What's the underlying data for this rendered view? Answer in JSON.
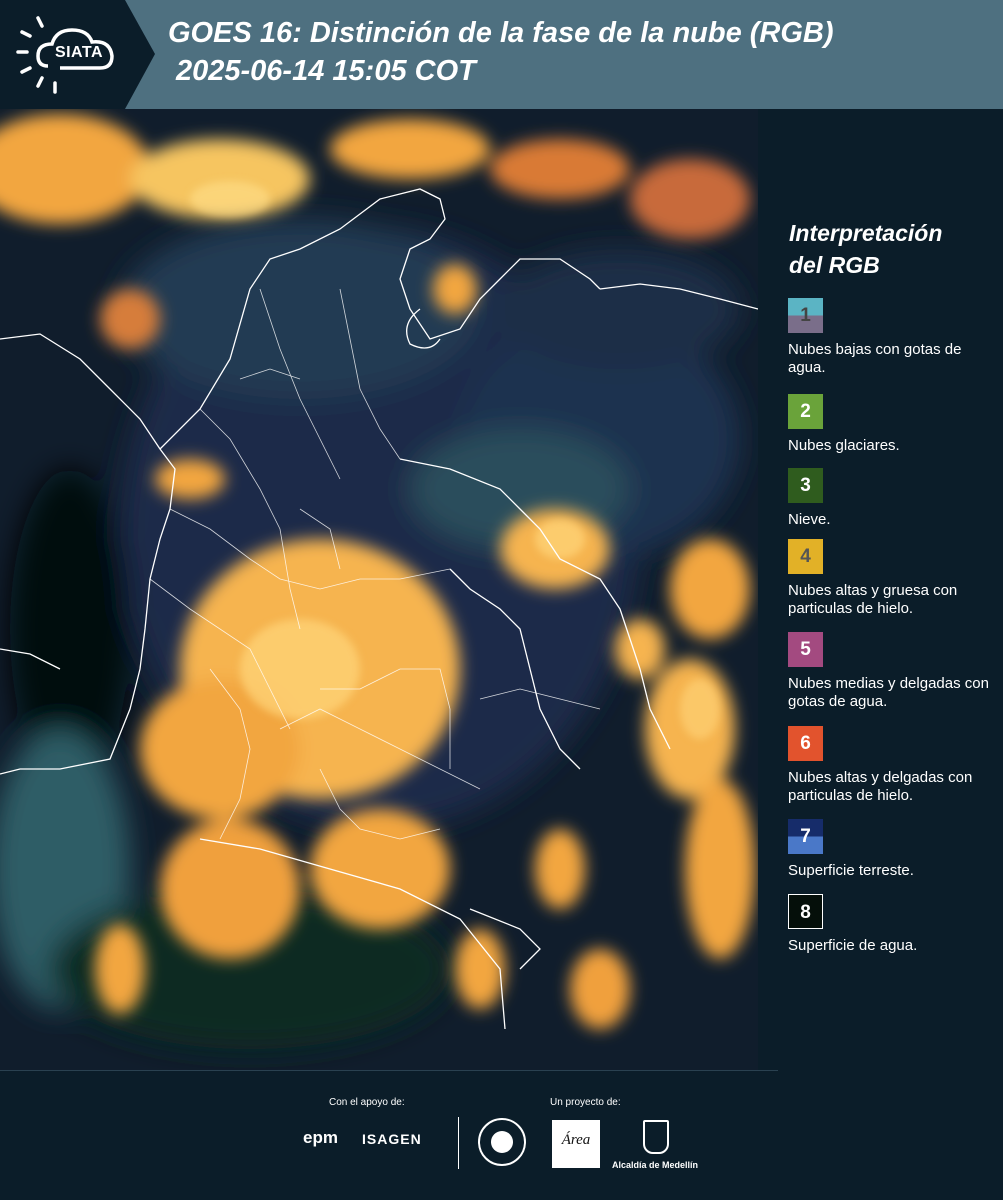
{
  "header": {
    "logo_text": "SIATA",
    "title_line1": "GOES 16: Distinción de la fase de la nube (RGB)",
    "title_line2": "2025-06-14 15:05 COT"
  },
  "legend": {
    "title_line1": "Interpretación",
    "title_line2": "del RGB",
    "items": [
      {
        "number": "1",
        "label": "Nubes bajas con gotas de agua.",
        "color_top": "#5bb4c4",
        "color_bottom": "#7a6e8a",
        "text_color": "#444444"
      },
      {
        "number": "2",
        "label": "Nubes glaciares.",
        "color_top": "#6aa33a",
        "color_bottom": "#6aa33a",
        "text_color": "#ffffff"
      },
      {
        "number": "3",
        "label": "Nieve.",
        "color_top": "#2f5c1e",
        "color_bottom": "#2f5c1e",
        "text_color": "#ffffff"
      },
      {
        "number": "4",
        "label": "Nubes altas y gruesa con particulas de hielo.",
        "color_top": "#e2b127",
        "color_bottom": "#e2b127",
        "text_color": "#555555"
      },
      {
        "number": "5",
        "label": "Nubes medias y delgadas con gotas de agua.",
        "color_top": "#a34a80",
        "color_bottom": "#a34a80",
        "text_color": "#ffffff"
      },
      {
        "number": "6",
        "label": "Nubes altas y delgadas con particulas de hielo.",
        "color_top": "#e2532d",
        "color_bottom": "#e2532d",
        "text_color": "#ffffff"
      },
      {
        "number": "7",
        "label": "Superficie terreste.",
        "color_top": "#162c6a",
        "color_bottom": "#4a78c8",
        "text_color": "#ffffff"
      },
      {
        "number": "8",
        "label": "Superficie de agua.",
        "color_top": "#050f0a",
        "color_bottom": "#050f0a",
        "text_color": "#ffffff"
      }
    ]
  },
  "footer": {
    "support_label": "Con el apoyo de:",
    "project_label": "Un proyecto de:",
    "sponsors": [
      "epm",
      "ISAGEN"
    ],
    "partners": {
      "area_logo_text": "Área",
      "alcaldia_label": "Alcaldía de Medellín"
    }
  },
  "colors": {
    "header_bg": "#4e7080",
    "page_bg": "#0b1d29",
    "cloud_orange": "#f2a640",
    "cloud_yellow": "#f6c560"
  }
}
